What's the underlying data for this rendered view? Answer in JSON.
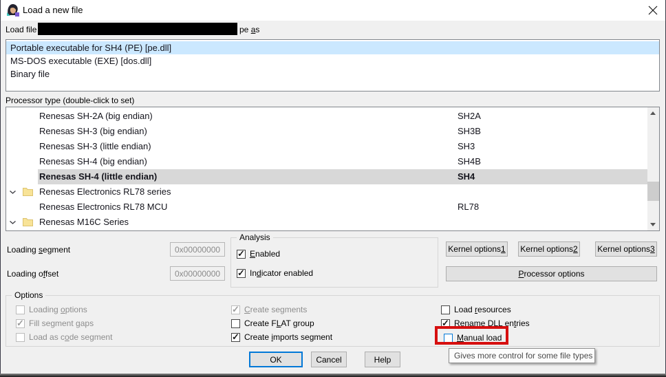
{
  "window": {
    "title": "Load a new file"
  },
  "load_file": {
    "prefix": "Load file",
    "suffix": {
      "pre": "pe ",
      "u": "a",
      "post": "s"
    }
  },
  "filetype_list": {
    "selected_index": 0,
    "items": [
      "Portable executable for SH4 (PE) [pe.dll]",
      "MS-DOS executable (EXE) [dos.dll]",
      "Binary file"
    ]
  },
  "processor": {
    "label": "Processor type (double-click to set)",
    "selected_index": 4,
    "rows": [
      {
        "name": "Renesas SH-2A (big endian)",
        "code": "SH2A"
      },
      {
        "name": "Renesas SH-3 (big endian)",
        "code": "SH3B"
      },
      {
        "name": "Renesas SH-3 (little endian)",
        "code": "SH3"
      },
      {
        "name": "Renesas SH-4 (big endian)",
        "code": "SH4B"
      },
      {
        "name": "Renesas SH-4 (little endian)",
        "code": "SH4"
      },
      {
        "name": "Renesas Electronics RL78 series",
        "code": ""
      },
      {
        "name": "Renesas Electronics RL78 MCU",
        "code": "RL78"
      },
      {
        "name": "Renesas M16C Series",
        "code": ""
      }
    ]
  },
  "loading": {
    "segment_label": {
      "pre": "Loading ",
      "u": "s",
      "post": "egment"
    },
    "segment_value": "0x00000000",
    "offset_label": {
      "pre": "Loading o",
      "u": "f",
      "post": "fset"
    },
    "offset_value": "0x00000000"
  },
  "analysis": {
    "title": "Analysis",
    "enabled": {
      "pre": "",
      "u": "E",
      "post": "nabled"
    },
    "indicator": {
      "pre": "In",
      "u": "d",
      "post": "icator enabled"
    }
  },
  "kernel_buttons": {
    "k1": {
      "pre": "Kernel options ",
      "u": "1",
      "post": ""
    },
    "k2": {
      "pre": "Kernel options ",
      "u": "2",
      "post": ""
    },
    "k3": {
      "pre": "Kernel options ",
      "u": "3",
      "post": ""
    },
    "processor_options": {
      "pre": "",
      "u": "P",
      "post": "rocessor options"
    }
  },
  "options": {
    "title": "Options",
    "loading_options": {
      "pre": "Loading ",
      "u": "o",
      "post": "ptions"
    },
    "fill_segment_gaps": {
      "pre": "Fill segment ",
      "u": "g",
      "post": "aps"
    },
    "load_as_code": {
      "pre": "Load as c",
      "u": "o",
      "post": "de segment"
    },
    "create_segments": {
      "pre": "",
      "u": "C",
      "post": "reate segments"
    },
    "create_flat": {
      "pre": "Create F",
      "u": "L",
      "post": "AT group"
    },
    "create_imports": {
      "pre": "Create ",
      "u": "i",
      "post": "mports segment"
    },
    "load_resources": {
      "pre": "Load ",
      "u": "r",
      "post": "esources"
    },
    "rename_dll": {
      "pre": "Rename DLL en",
      "u": "t",
      "post": "ries"
    },
    "manual_load": {
      "pre": "",
      "u": "M",
      "post": "anual load"
    }
  },
  "dialog_buttons": {
    "ok": "OK",
    "cancel": "Cancel",
    "help": "Help"
  },
  "tooltip": {
    "text": "Gives more control for some file types"
  },
  "colors": {
    "accent": "#0078d7",
    "file_selection": "#cbe8ff",
    "processor_selection": "#d8d8d8",
    "annotation_red": "#d60f0f",
    "folder_yellow": "#f8e397"
  }
}
